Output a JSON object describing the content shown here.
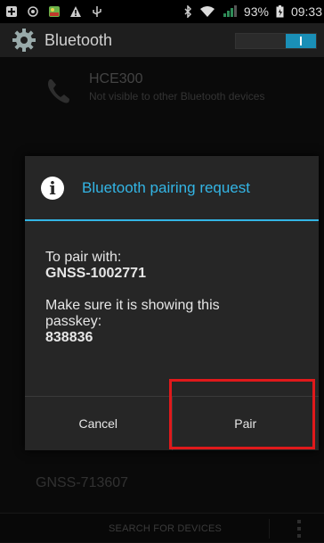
{
  "status": {
    "battery": "93%",
    "time": "09:33"
  },
  "appbar": {
    "title": "Bluetooth"
  },
  "device": {
    "name": "HCE300",
    "subtitle": "Not visible to other Bluetooth devices"
  },
  "dialog": {
    "title": "Bluetooth pairing request",
    "pair_with_label": "To pair with:",
    "device_name": "GNSS-1002771",
    "message": "Make sure it is showing this passkey:",
    "passkey": "838836",
    "cancel_label": "Cancel",
    "pair_label": "Pair"
  },
  "other_device": "GNSS-713607",
  "bottom": {
    "search_label": "SEARCH FOR DEVICES"
  }
}
